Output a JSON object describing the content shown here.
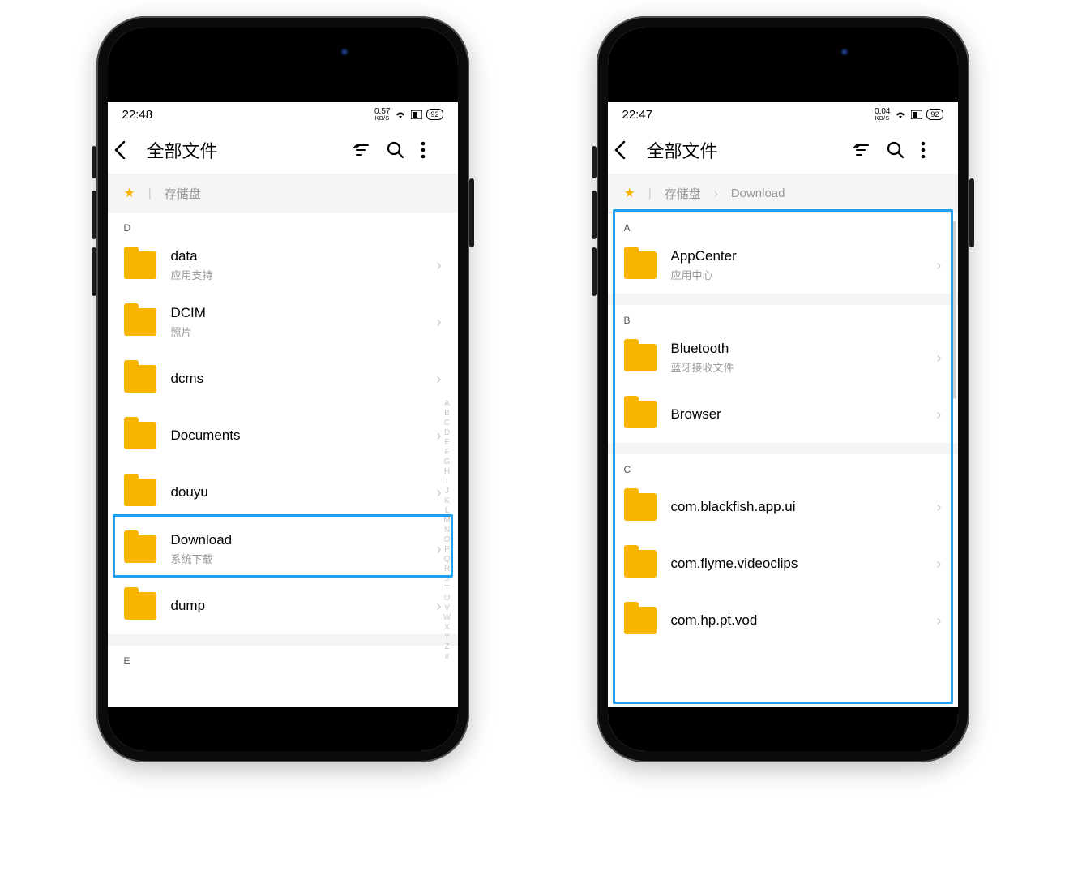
{
  "left": {
    "status": {
      "time": "22:48",
      "speed": "0.57",
      "speed_unit": "KB/S",
      "battery": "92"
    },
    "header": {
      "title": "全部文件"
    },
    "crumbs": {
      "root": "存储盘"
    },
    "sections": [
      {
        "letter": "D",
        "items": [
          {
            "name": "data",
            "sub": "应用支持"
          },
          {
            "name": "DCIM",
            "sub": "照片"
          },
          {
            "name": "dcms",
            "sub": ""
          },
          {
            "name": "Documents",
            "sub": ""
          },
          {
            "name": "douyu",
            "sub": ""
          },
          {
            "name": "Download",
            "sub": "系统下载"
          },
          {
            "name": "dump",
            "sub": ""
          }
        ]
      },
      {
        "letter": "E",
        "items": []
      }
    ],
    "alpha": [
      "A",
      "B",
      "C",
      "D",
      "E",
      "F",
      "G",
      "H",
      "I",
      "J",
      "K",
      "L",
      "M",
      "N",
      "O",
      "P",
      "Q",
      "R",
      "S",
      "T",
      "U",
      "V",
      "W",
      "X",
      "Y",
      "Z",
      "#"
    ]
  },
  "right": {
    "status": {
      "time": "22:47",
      "speed": "0.04",
      "speed_unit": "KB/S",
      "battery": "92"
    },
    "header": {
      "title": "全部文件"
    },
    "crumbs": {
      "root": "存储盘",
      "current": "Download"
    },
    "sections": [
      {
        "letter": "A",
        "items": [
          {
            "name": "AppCenter",
            "sub": "应用中心"
          }
        ]
      },
      {
        "letter": "B",
        "items": [
          {
            "name": "Bluetooth",
            "sub": "蓝牙接收文件"
          },
          {
            "name": "Browser",
            "sub": ""
          }
        ]
      },
      {
        "letter": "C",
        "items": [
          {
            "name": "com.blackfish.app.ui",
            "sub": ""
          },
          {
            "name": "com.flyme.videoclips",
            "sub": ""
          },
          {
            "name": "com.hp.pt.vod",
            "sub": ""
          }
        ]
      }
    ]
  }
}
